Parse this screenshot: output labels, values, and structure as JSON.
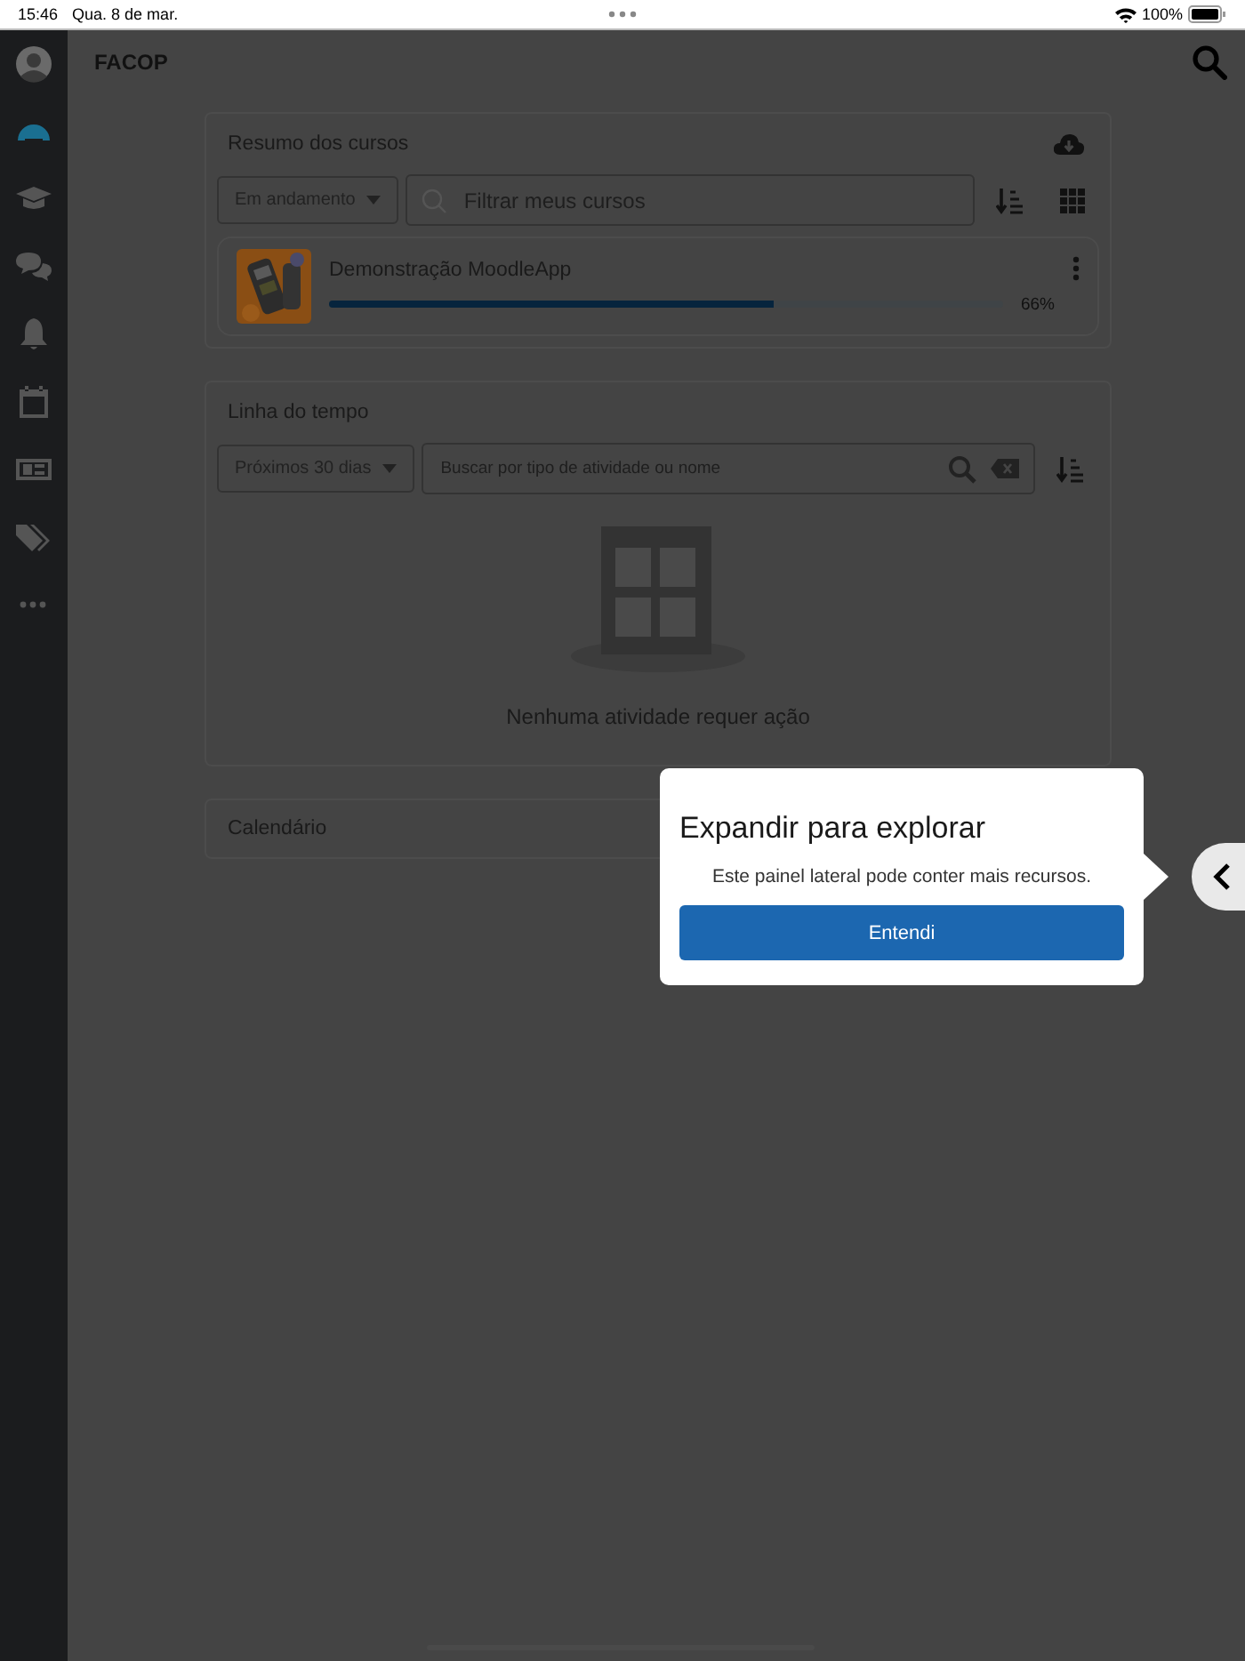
{
  "status_bar": {
    "time": "15:46",
    "date": "Qua. 8 de mar.",
    "battery": "100%"
  },
  "sidebar": {
    "items": [
      {
        "kind": "avatar",
        "selected": false
      },
      {
        "kind": "dashboard",
        "selected": true
      },
      {
        "kind": "courses",
        "selected": false
      },
      {
        "kind": "messages",
        "selected": false
      },
      {
        "kind": "notifications",
        "selected": false
      },
      {
        "kind": "calendar",
        "selected": false
      },
      {
        "kind": "grades",
        "selected": false
      },
      {
        "kind": "tags",
        "selected": false
      },
      {
        "kind": "more",
        "selected": false
      }
    ]
  },
  "header": {
    "title": "FACOP"
  },
  "course_overview": {
    "title": "Resumo dos cursos",
    "filter": "Em andamento",
    "search": {
      "placeholder": "Filtrar meus cursos"
    },
    "courses": [
      {
        "name": "Demonstração MoodleApp",
        "level": 0.66,
        "progress": "66%"
      }
    ]
  },
  "timeline": {
    "title": "Linha do tempo",
    "filter": "Próximos 30 dias",
    "search": {
      "placeholder": "Buscar por tipo de atividade ou nome"
    },
    "empty_message": "Nenhuma atividade requer ação"
  },
  "calendar": {
    "title": "Calendário"
  },
  "popover": {
    "title": "Expandir para explorar",
    "message": "Este painel lateral pode conter mais recursos.",
    "button": "Entendi"
  }
}
